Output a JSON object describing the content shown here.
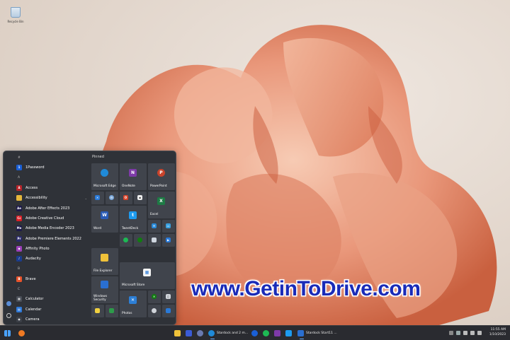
{
  "desktop": {
    "icon_label": "Recycle Bin",
    "watermark": "www.GetinToDrive.com",
    "wallpaper_colors": [
      "#e8a58c",
      "#d9785e",
      "#f3c1a8"
    ]
  },
  "start_menu": {
    "pinned_title": "Pinned",
    "apps": [
      {
        "type": "header",
        "label": "#"
      },
      {
        "label": "1Password",
        "icon": "1password-icon",
        "color": "#1a5fd6",
        "glyph": "1"
      },
      {
        "type": "header",
        "label": "A"
      },
      {
        "label": "Access",
        "icon": "access-icon",
        "color": "#b7242a",
        "glyph": "A"
      },
      {
        "label": "Accessibility",
        "icon": "folder-icon",
        "color": "#e5b73b",
        "glyph": "",
        "chevron": "⌄"
      },
      {
        "label": "Adobe After Effects 2023",
        "icon": "after-effects-icon",
        "color": "#1d1a4a",
        "glyph": "Ae"
      },
      {
        "label": "Adobe Creative Cloud",
        "icon": "creative-cloud-icon",
        "color": "#da1f26",
        "glyph": "Cc"
      },
      {
        "label": "Adobe Media Encoder 2023",
        "icon": "media-encoder-icon",
        "color": "#1d1a4a",
        "glyph": "Me"
      },
      {
        "label": "Adobe Premiere Elements 2022",
        "icon": "premiere-elements-icon",
        "color": "#2a2a6a",
        "glyph": "Pr"
      },
      {
        "label": "Affinity Photo",
        "icon": "affinity-photo-icon",
        "color": "#9b3fb8",
        "glyph": "◆"
      },
      {
        "label": "Audacity",
        "icon": "audacity-icon",
        "color": "#1b3c8c",
        "glyph": "♪"
      },
      {
        "type": "header",
        "label": "B"
      },
      {
        "label": "Brave",
        "icon": "brave-icon",
        "color": "#e8532b",
        "glyph": "B"
      },
      {
        "type": "header",
        "label": "C"
      },
      {
        "label": "Calculator",
        "icon": "calculator-icon",
        "color": "#4a4f58",
        "glyph": "▦"
      },
      {
        "label": "Calendar",
        "icon": "calendar-icon",
        "color": "#2f79d8",
        "glyph": "▤"
      },
      {
        "label": "Camera",
        "icon": "camera-icon",
        "color": "#3b3f47",
        "glyph": "◉"
      }
    ],
    "tiles": {
      "edge": "Microsoft Edge",
      "onenote": "OneNote",
      "powerpoint": "PowerPoint",
      "excel": "Excel",
      "word": "Word",
      "tweetdeck": "TweetDeck",
      "file_explorer": "File Explorer",
      "store": "Microsoft Store",
      "security": "Windows Security",
      "photos": "Photos"
    }
  },
  "taskbar": {
    "apps": [
      {
        "label": "Stardock and 2 m..."
      },
      {
        "label": "Stardock Start11 ..."
      }
    ],
    "time": "11:55 AM",
    "date": "1/10/2023"
  },
  "colors": {
    "edge": "#1f8ad8",
    "onenote": "#7e3aa8",
    "powerpoint": "#c9432b",
    "excel": "#1e7a45",
    "word": "#2a5bb5",
    "twitter": "#1d9bf0",
    "explorer": "#f0c23a",
    "store": "#f4f4f4",
    "security": "#2a6fd1",
    "photos": "#2d7fd6"
  }
}
